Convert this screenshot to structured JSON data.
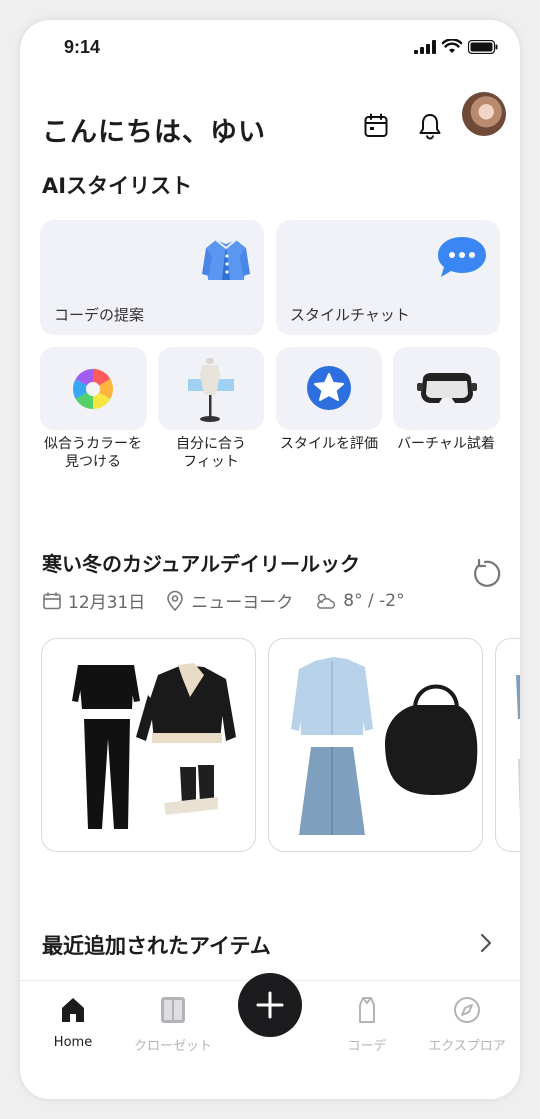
{
  "status": {
    "time": "9:14"
  },
  "header": {
    "greeting": "こんにちは、ゆい"
  },
  "ai_stylist": {
    "title": "AIスタイリスト",
    "large_cards": [
      {
        "label": "コーデの提案",
        "icon": "cardigan-icon"
      },
      {
        "label": "スタイルチャット",
        "icon": "chat-bubble-icon"
      }
    ],
    "small_cards": [
      {
        "label_line1": "似合うカラーを",
        "label_line2": "見つける",
        "icon": "color-wheel-icon"
      },
      {
        "label_line1": "自分に合う",
        "label_line2": "フィット",
        "icon": "mannequin-icon"
      },
      {
        "label_line1": "スタイルを評価",
        "label_line2": "",
        "icon": "star-badge-icon"
      },
      {
        "label_line1": "バーチャル試着",
        "label_line2": "",
        "icon": "vr-headset-icon"
      }
    ]
  },
  "daily_look": {
    "title": "寒い冬のカジュアルデイリールック",
    "date": "12月31日",
    "location": "ニューヨーク",
    "weather": "8° / -2°"
  },
  "recent_items": {
    "title": "最近追加されたアイテム"
  },
  "tabbar": {
    "tabs": [
      {
        "label": "Home",
        "icon": "home-icon"
      },
      {
        "label": "クローゼット",
        "icon": "closet-icon"
      },
      {
        "label": "コーデ",
        "icon": "outfit-icon"
      },
      {
        "label": "エクスプロア",
        "icon": "compass-icon"
      }
    ]
  },
  "colors": {
    "accent": "#1c1c1e",
    "card_bg": "#f1f2f7",
    "inactive": "#b4b4b8",
    "brand_blue": "#3a7ff5"
  }
}
